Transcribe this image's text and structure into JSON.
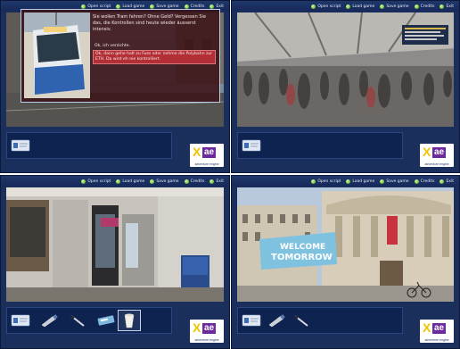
{
  "menu": [
    {
      "label": "Open script"
    },
    {
      "label": "Load game"
    },
    {
      "label": "Save game"
    },
    {
      "label": "Credits"
    },
    {
      "label": "Exit"
    }
  ],
  "dialog": {
    "prompt": "Sie wollen Tram fahren? Ohne Geld? Vergessen Sie das, die Kontrollen sind heute wieder äusserst intensiv.",
    "options": [
      "Ok, ich verzichte.",
      "Ok, dann gehe halt zu Fuss oder nehme die Polybahn zur ETH. Da wird eh nie kontrolliert."
    ]
  },
  "banner": {
    "line1": "WELCOME",
    "line2": "TOMORROW"
  },
  "logo": {
    "mark": "X",
    "brand": "ae",
    "tagline": "adventure engine"
  },
  "colors": {
    "panel": "#1a2f5c",
    "menu_dot": "#3e9a1c",
    "dialog_highlight": "#b32f36"
  }
}
